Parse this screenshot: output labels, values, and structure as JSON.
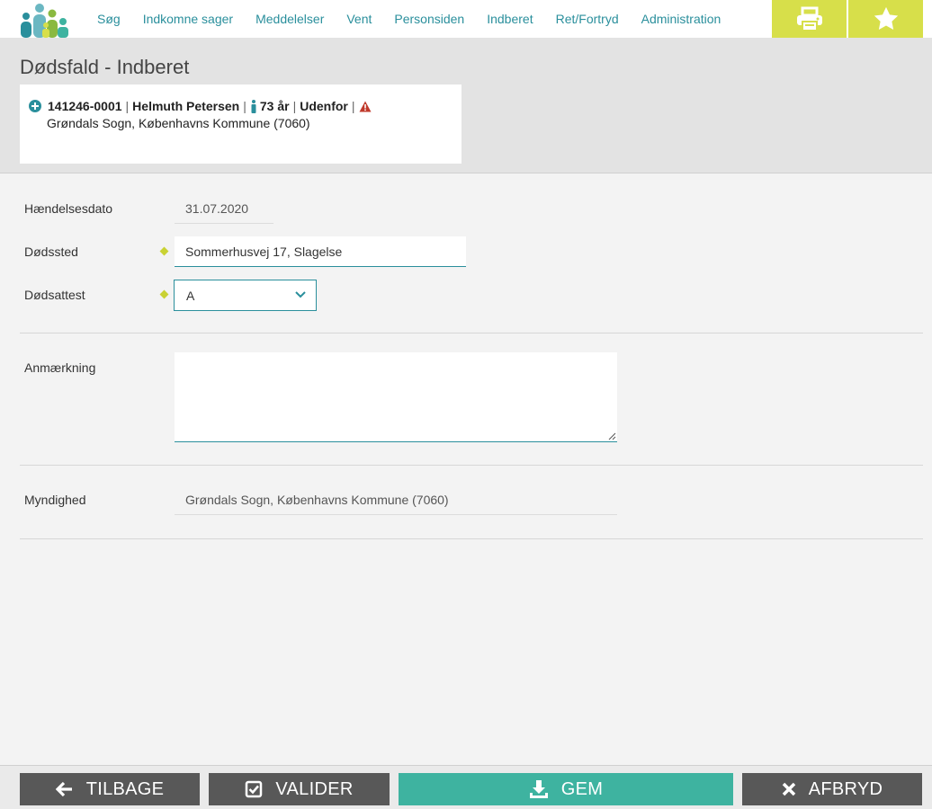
{
  "nav": {
    "items": [
      "Søg",
      "Indkomne sager",
      "Meddelelser",
      "Vent",
      "Personsiden",
      "Indberet",
      "Ret/Fortryd",
      "Administration"
    ],
    "print_icon": "printer-icon",
    "favorite_icon": "star-icon"
  },
  "page": {
    "title": "Dødsfald - Indberet"
  },
  "person": {
    "cpr": "141246-0001",
    "name": "Helmuth Petersen",
    "age": "73 år",
    "status": "Udenfor",
    "location": "Grøndals Sogn, Københavns Kommune (7060)"
  },
  "form": {
    "event_date_label": "Hændelsesdato",
    "event_date_value": "31.07.2020",
    "death_place_label": "Dødssted",
    "death_place_value": "Sommerhusvej 17, Slagelse",
    "certificate_label": "Dødsattest",
    "certificate_value": "A",
    "remark_label": "Anmærkning",
    "remark_value": "",
    "authority_label": "Myndighed",
    "authority_value": "Grøndals Sogn, Københavns Kommune (7060)"
  },
  "footer": {
    "back_label": "TILBAGE",
    "validate_label": "VALIDER",
    "save_label": "GEM",
    "cancel_label": "AFBRYD"
  },
  "colors": {
    "accent_teal": "#2a8f9c",
    "save_green": "#3eb3a0",
    "topbar_yellow": "#d7df4a",
    "warning_red": "#c0392b"
  }
}
